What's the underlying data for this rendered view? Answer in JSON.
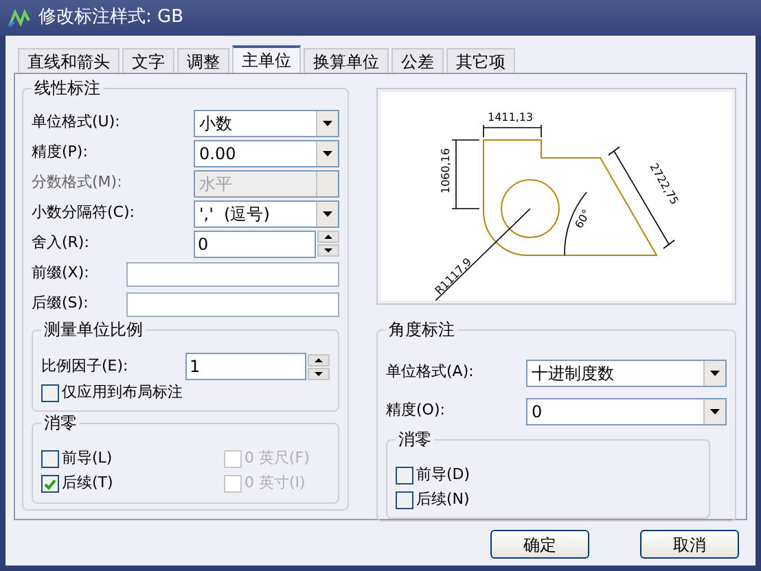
{
  "window": {
    "title": "修改标注样式: GB"
  },
  "tabs": [
    {
      "label": "直线和箭头",
      "selected": false
    },
    {
      "label": "文字",
      "selected": false
    },
    {
      "label": "调整",
      "selected": false
    },
    {
      "label": "主单位",
      "selected": true
    },
    {
      "label": "换算单位",
      "selected": false
    },
    {
      "label": "公差",
      "selected": false
    },
    {
      "label": "其它项",
      "selected": false
    }
  ],
  "linear": {
    "title": "线性标注",
    "fields": [
      {
        "kind": "select",
        "label": "单位格式(U):",
        "value": "小数",
        "disabled": false
      },
      {
        "kind": "select",
        "label": "精度(P):",
        "value": "0.00",
        "disabled": false
      },
      {
        "kind": "select",
        "label": "分数格式(M):",
        "value": "水平",
        "disabled": true
      },
      {
        "kind": "select",
        "label": "小数分隔符(C):",
        "value": "','  (逗号)",
        "disabled": false
      },
      {
        "kind": "spin",
        "label": "舍入(R):",
        "value": "0",
        "disabled": false
      },
      {
        "kind": "text",
        "label": "前缀(X):",
        "disabled": false
      },
      {
        "kind": "text",
        "label": "后缀(S):",
        "disabled": false
      }
    ],
    "scale": {
      "title": "测量单位比例",
      "factor_label": "比例因子(E):",
      "factor": "1",
      "layout_only": {
        "label": "仅应用到布局标注",
        "checked": false
      }
    },
    "zero": {
      "title": "消零",
      "items": [
        {
          "label": "前导(L)",
          "checked": false,
          "disabled": false
        },
        {
          "label": "0 英尺(F)",
          "checked": false,
          "disabled": true
        },
        {
          "label": "后续(T)",
          "checked": true,
          "disabled": false
        },
        {
          "label": "0 英寸(I)",
          "checked": false,
          "disabled": true
        }
      ]
    }
  },
  "preview": {
    "labels": [
      "1411,13",
      "1060,16",
      "2722,75",
      "60°",
      "R1117,9"
    ]
  },
  "angular": {
    "title": "角度标注",
    "fields": [
      {
        "label": "单位格式(A):",
        "value": "十进制度数"
      },
      {
        "label": "精度(O):",
        "value": "0"
      }
    ],
    "zero": {
      "title": "消零",
      "items": [
        {
          "label": "前导(D)",
          "checked": false
        },
        {
          "label": "后续(N)",
          "checked": false
        }
      ]
    }
  },
  "buttons": [
    "确定",
    "取消"
  ]
}
